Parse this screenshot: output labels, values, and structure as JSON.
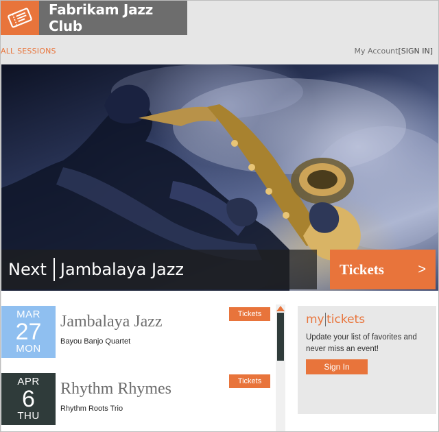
{
  "header": {
    "logo_icon": "ticket-icon",
    "title": "Fabrikam Jazz Club"
  },
  "nav": {
    "all_sessions": "ALL SESSIONS",
    "my_account": "My Account",
    "sign_in": "[SIGN IN]"
  },
  "hero": {
    "next_label": "Next",
    "next_title": "Jambalaya Jazz",
    "tickets_label": "Tickets",
    "tickets_arrow": ">"
  },
  "events": [
    {
      "month": "MAR",
      "day": "27",
      "weekday": "MON",
      "name": "Jambalaya Jazz",
      "band": "Bayou Banjo Quartet",
      "tickets_label": "Tickets",
      "tile_color": "#8fbff0",
      "tile_text_color": "#ffffff"
    },
    {
      "month": "APR",
      "day": "6",
      "weekday": "THU",
      "name": "Rhythm Rhymes",
      "band": "Rhythm Roots Trio",
      "tickets_label": "Tickets",
      "tile_color": "#2f3b3a",
      "tile_text_color": "#ffffff"
    }
  ],
  "mytickets": {
    "title_my": "my",
    "title_tickets": "tickets",
    "description": "Update your list of favorites and never miss an event!",
    "signin_label": "Sign In"
  },
  "colors": {
    "accent": "#e8743b",
    "header_gray": "#6d6d6d"
  }
}
